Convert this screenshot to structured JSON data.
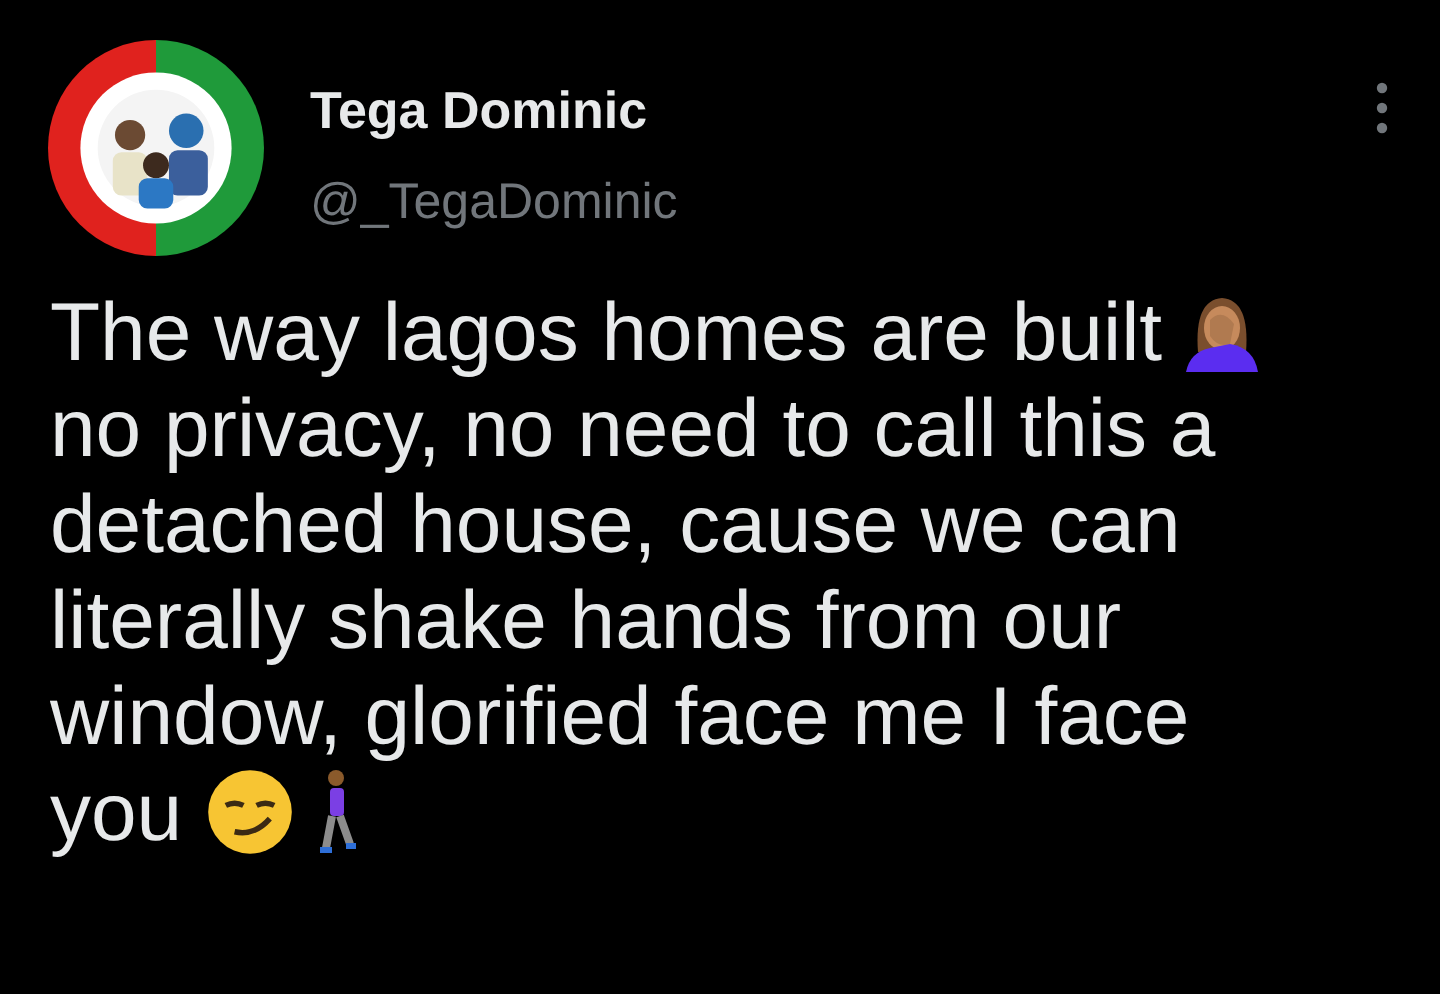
{
  "author": {
    "name": "Tega Dominic",
    "handle": "@_TegaDominic"
  },
  "tweet": {
    "lines": [
      [
        {
          "kind": "text",
          "text": "The way lagos homes are built"
        },
        {
          "kind": "facepalm-emoji"
        }
      ],
      [
        {
          "kind": "text",
          "text": "no privacy, no need to call this a"
        }
      ],
      [
        {
          "kind": "text",
          "text": "detached house, cause we can"
        }
      ],
      [
        {
          "kind": "text",
          "text": "literally shake hands from our"
        }
      ],
      [
        {
          "kind": "text",
          "text": "window, glorified face me I face"
        }
      ],
      [
        {
          "kind": "text",
          "text": "you"
        },
        {
          "kind": "smirk-emoji"
        },
        {
          "kind": "walking-emoji"
        }
      ]
    ]
  }
}
